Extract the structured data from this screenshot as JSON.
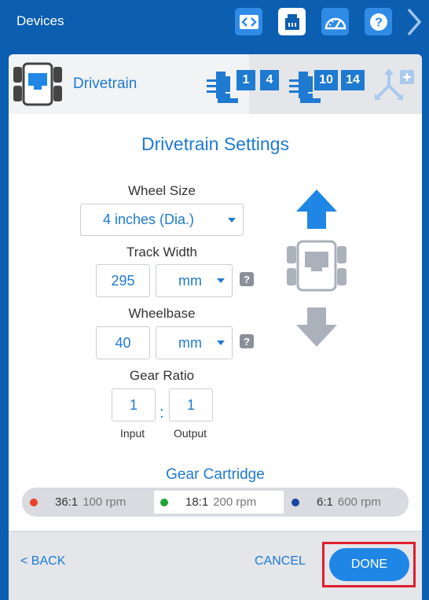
{
  "topbar": {
    "title": "Devices",
    "buttons": [
      {
        "name": "code-icon"
      },
      {
        "name": "ports-icon",
        "active": true
      },
      {
        "name": "dashboard-icon"
      },
      {
        "name": "help-icon"
      }
    ],
    "next_icon": "chevron-right-icon"
  },
  "device": {
    "name": "Drivetrain",
    "icon": "drivetrain-icon",
    "left_motor_ports": [
      "1",
      "4"
    ],
    "right_motor_ports": [
      "10",
      "14"
    ],
    "gyro_icon": "gyro-add-icon"
  },
  "settings": {
    "title": "Drivetrain Settings",
    "wheel_size": {
      "label": "Wheel Size",
      "value": "4 inches (Dia.)"
    },
    "track_width": {
      "label": "Track Width",
      "value": "295",
      "unit": "mm"
    },
    "wheelbase": {
      "label": "Wheelbase",
      "value": "40",
      "unit": "mm"
    },
    "gear_ratio": {
      "label": "Gear Ratio",
      "input": "1",
      "output": "1",
      "separator": ":",
      "input_label": "Input",
      "output_label": "Output"
    },
    "help_glyph": "?"
  },
  "gear_cartridge": {
    "title": "Gear Cartridge",
    "options": [
      {
        "ratio": "36:1",
        "rpm": "100 rpm",
        "color": "#e8412a"
      },
      {
        "ratio": "18:1",
        "rpm": "200 rpm",
        "color": "#22a33a",
        "selected": true
      },
      {
        "ratio": "6:1",
        "rpm": "600 rpm",
        "color": "#1947a3"
      }
    ]
  },
  "footer": {
    "back": "< BACK",
    "cancel": "CANCEL",
    "done": "DONE"
  },
  "colors": {
    "accent": "#1f7ad1",
    "topbar": "#0c5eb0",
    "highlight": "#e01e2c"
  }
}
